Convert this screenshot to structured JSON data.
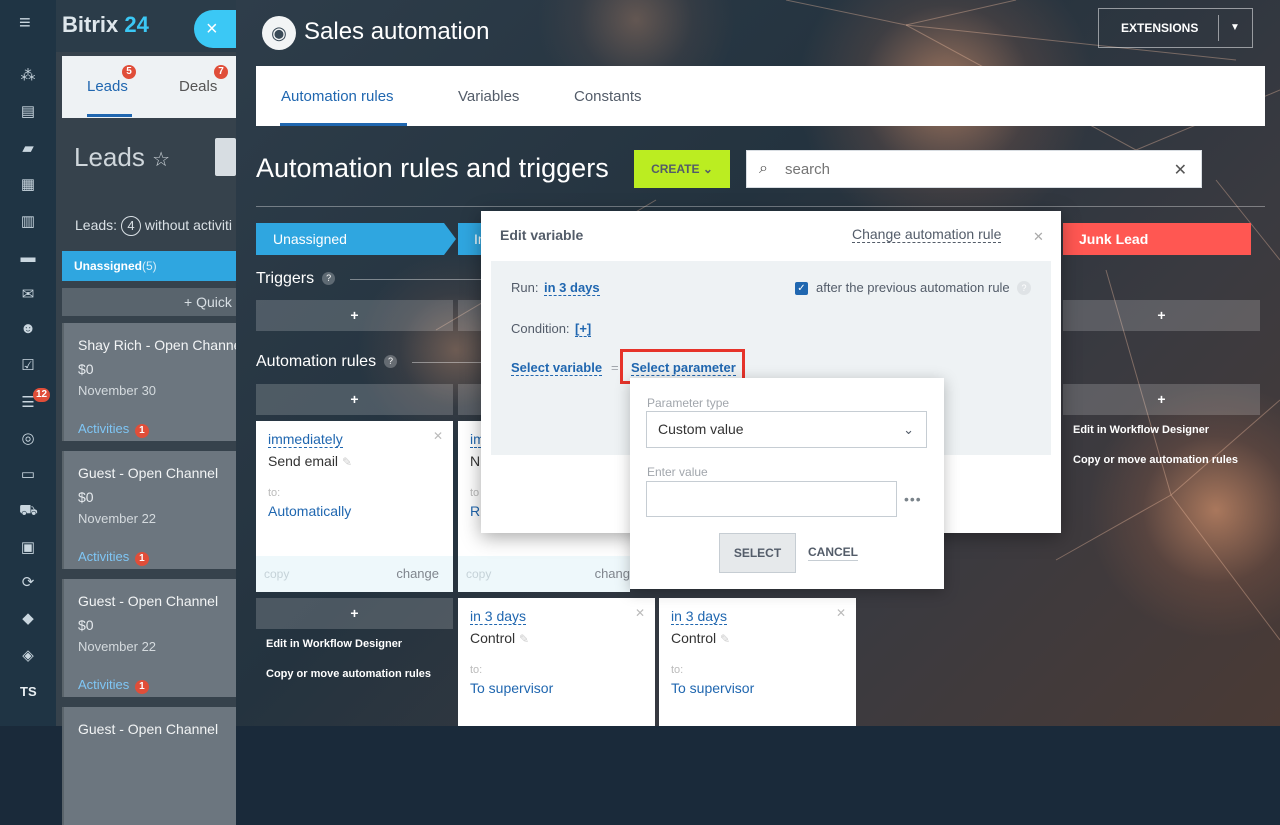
{
  "sidebar": {
    "brand_main": "Bitrix",
    "brand_num": "24",
    "close_glyph": "×",
    "badge": "12",
    "user_initials": "TS"
  },
  "crm": {
    "tabs": [
      {
        "label": "Leads",
        "badge": "5"
      },
      {
        "label": "Deals",
        "badge": "7"
      }
    ],
    "heading": "Leads",
    "leads_prefix": "Leads:",
    "leads_count": "4",
    "leads_suffix": "without activiti",
    "stage": "Unassigned",
    "stage_count": "(5)",
    "quick": "+ Quick",
    "cards": [
      {
        "name": "Shay Rich - Open Channel",
        "amount": "$0",
        "date": "November 30",
        "activities": "Activities",
        "badge": "1"
      },
      {
        "name": "Guest - Open Channel",
        "amount": "$0",
        "date": "November 22",
        "activities": "Activities",
        "badge": "1"
      },
      {
        "name": "Guest - Open Channel",
        "amount": "$0",
        "date": "November 22",
        "activities": "Activities",
        "badge": "1"
      },
      {
        "name": "Guest - Open Channel",
        "amount": "",
        "date": "",
        "activities": "",
        "badge": ""
      }
    ]
  },
  "header": {
    "title": "Sales automation",
    "extensions": "EXTENSIONS"
  },
  "tabs": [
    "Automation rules",
    "Variables",
    "Constants"
  ],
  "page": {
    "heading": "Automation rules and triggers",
    "create": "CREATE",
    "search_placeholder": "search"
  },
  "stages": {
    "first": "Unassigned",
    "second": "In",
    "junk": "Junk Lead"
  },
  "sections": {
    "triggers": "Triggers",
    "rules": "Automation rules"
  },
  "plus": "+",
  "rules": [
    {
      "when": "immediately",
      "title": "Send email",
      "to_label": "to:",
      "to_value": "Automatically",
      "copy": "copy",
      "change": "change"
    },
    {
      "when": "im",
      "title": "N",
      "to_label": "to",
      "to_value": "R",
      "copy": "copy",
      "change": "chang"
    },
    {
      "when": "in 3 days",
      "title": "Control",
      "to_label": "to:",
      "to_value": "To supervisor"
    },
    {
      "when": "in 3 days",
      "title": "Control",
      "to_label": "to:",
      "to_value": "To supervisor"
    }
  ],
  "side_links": {
    "edit": "Edit in Workflow Designer",
    "copy": "Copy or move automation rules"
  },
  "dialog": {
    "title": "Edit variable",
    "change_rule": "Change automation rule",
    "run_label": "Run:",
    "run_value": "in 3 days",
    "after_prev": "after the previous automation rule",
    "condition_label": "Condition:",
    "condition_value": "[+]",
    "select_variable": "Select variable",
    "equals": "=",
    "select_parameter": "Select parameter"
  },
  "popup": {
    "type_label": "Parameter type",
    "type_value": "Custom value",
    "value_label": "Enter value",
    "value": "",
    "dots": "•••",
    "select": "SELECT",
    "cancel": "CANCEL"
  }
}
